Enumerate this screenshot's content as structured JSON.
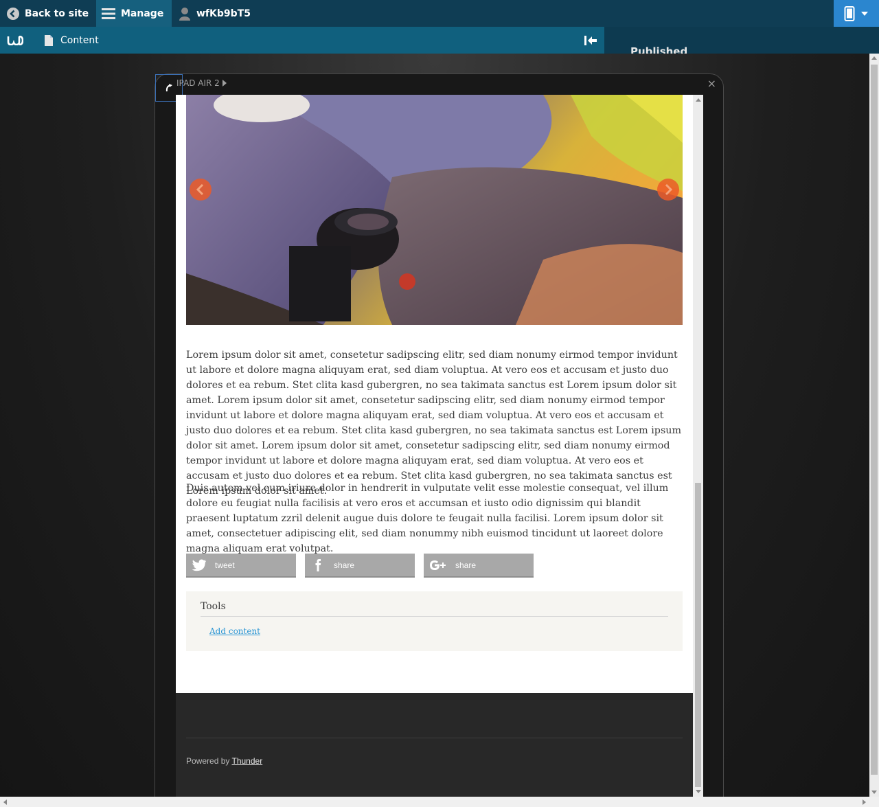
{
  "toolbar": {
    "back_label": "Back to site",
    "manage_label": "Manage",
    "user_label": "wfKb9bT5",
    "device_icon": "mobile-device-icon"
  },
  "tray": {
    "content_label": "Content",
    "status_text": "Published"
  },
  "device": {
    "name": "IPAD AIR 2",
    "close_glyph": "×"
  },
  "article": {
    "paragraphs": [
      "Lorem ipsum dolor sit amet, consetetur sadipscing elitr, sed diam nonumy eirmod tempor invidunt ut labore et dolore magna aliquyam erat, sed diam voluptua. At vero eos et accusam et justo duo dolores et ea rebum. Stet clita kasd gubergren, no sea takimata sanctus est Lorem ipsum dolor sit amet. Lorem ipsum dolor sit amet, consetetur sadipscing elitr, sed diam nonumy eirmod tempor invidunt ut labore et dolore magna aliquyam erat, sed diam voluptua. At vero eos et accusam et justo duo dolores et ea rebum. Stet clita kasd gubergren, no sea takimata sanctus est Lorem ipsum dolor sit amet. Lorem ipsum dolor sit amet, consetetur sadipscing elitr, sed diam nonumy eirmod tempor invidunt ut labore et dolore magna aliquyam erat, sed diam voluptua. At vero eos et accusam et justo duo dolores et ea rebum. Stet clita kasd gubergren, no sea takimata sanctus est Lorem ipsum dolor sit amet.",
      "Duis autem vel eum iriure dolor in hendrerit in vulputate velit esse molestie consequat, vel illum dolore eu feugiat nulla facilisis at vero eros et accumsan et iusto odio dignissim qui blandit praesent luptatum zzril delenit augue duis dolore te feugait nulla facilisi. Lorem ipsum dolor sit amet, consectetuer adipiscing elit, sed diam nonummy nibh euismod tincidunt ut laoreet dolore magna aliquam erat volutpat."
    ],
    "share": {
      "twitter_label": "tweet",
      "facebook_label": "share",
      "googleplus_label": "share"
    }
  },
  "tools": {
    "title": "Tools",
    "add_content_label": "Add content"
  },
  "footer": {
    "powered_by": "Powered by",
    "powered_link": "Thunder"
  },
  "colors": {
    "toolbar_bg": "#0f3d54",
    "manage_bg": "#16607e",
    "tray_bg": "#10607e",
    "device_button_bg": "#2b86cf",
    "carousel_arrow": "#eb5a28",
    "link": "#2a95d4",
    "footer_bg": "#282828"
  }
}
